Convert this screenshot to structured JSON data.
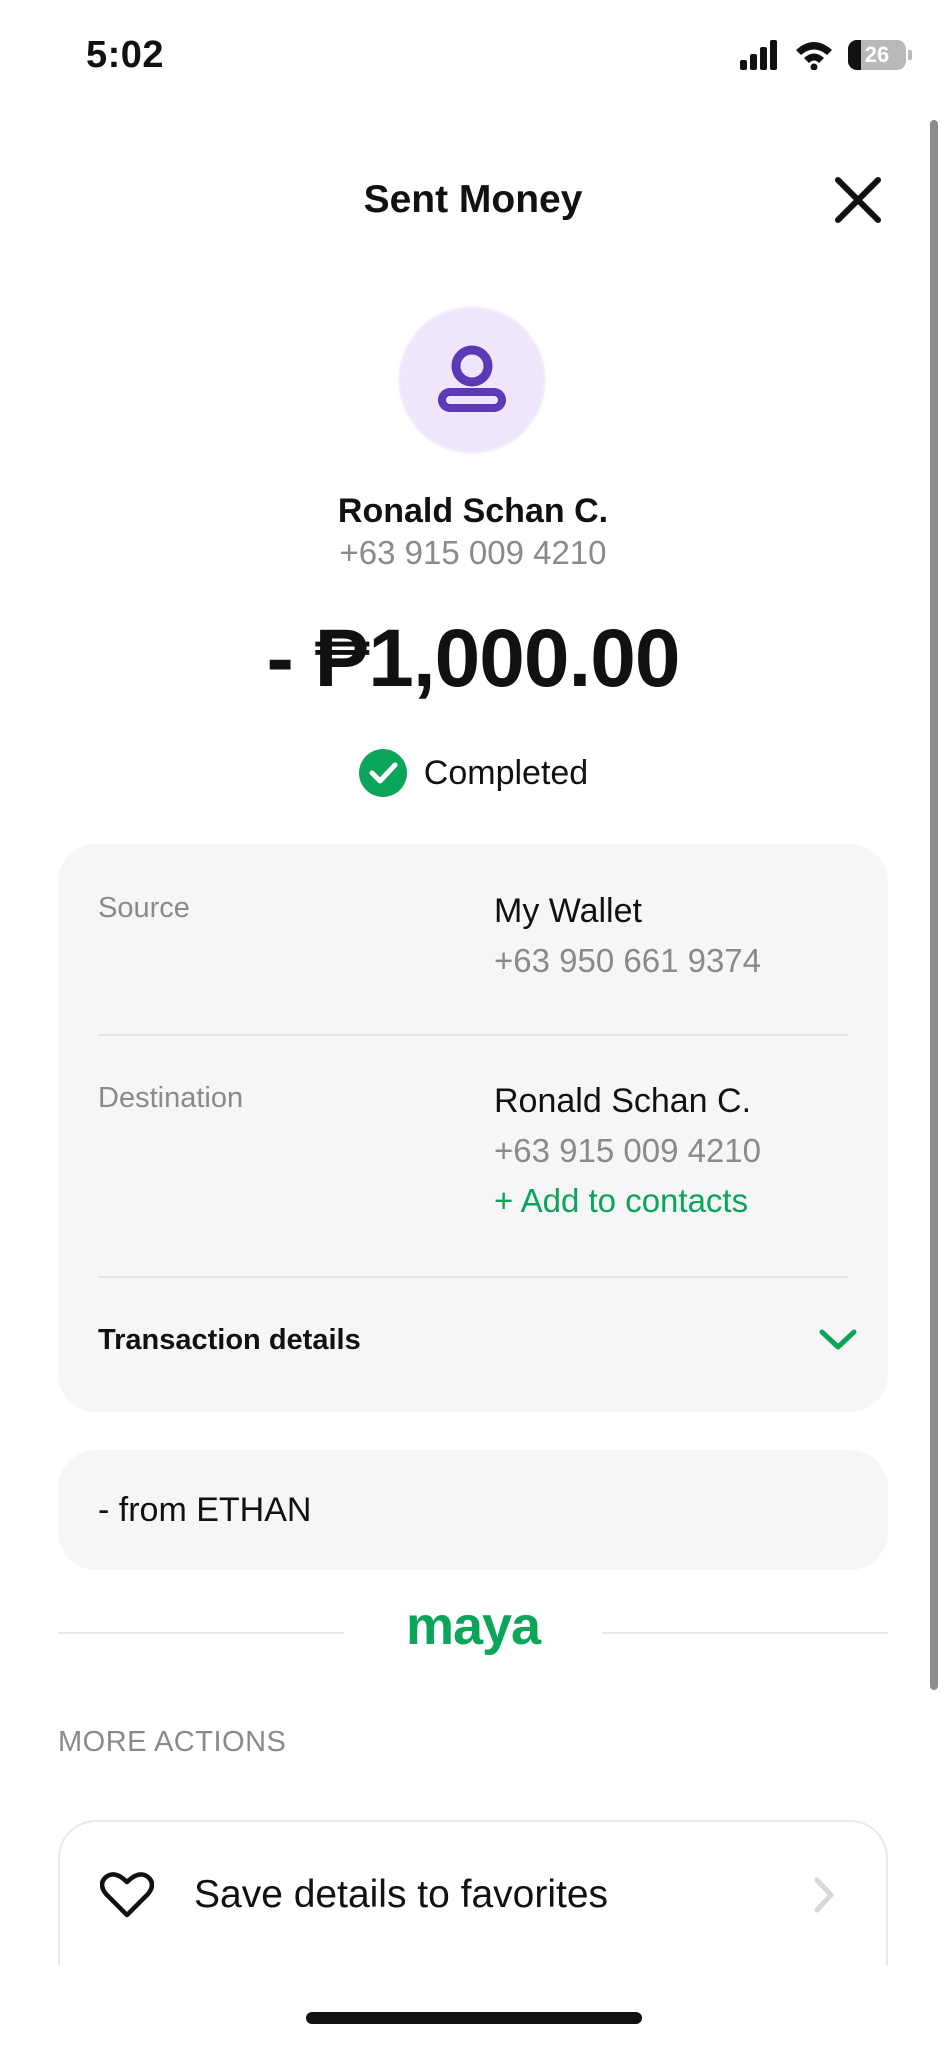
{
  "status_bar": {
    "time": "5:02",
    "battery": "26"
  },
  "header": {
    "title": "Sent Money"
  },
  "recipient": {
    "name": "Ronald Schan C.",
    "number": "+63 915 009 4210"
  },
  "amount": "- ₱1,000.00",
  "status": "Completed",
  "details": {
    "source_label": "Source",
    "source_name": "My Wallet",
    "source_number": "+63 950 661 9374",
    "destination_label": "Destination",
    "destination_name": "Ronald Schan C.",
    "destination_number": "+63 915 009 4210",
    "add_contact": "+ Add to contacts",
    "transaction_details": "Transaction details"
  },
  "note": "- from ETHAN",
  "brand": {
    "logo_text": "maya"
  },
  "more_actions": {
    "title": "MORE ACTIONS",
    "items": [
      {
        "label": "Save details to favorites"
      }
    ]
  },
  "colors": {
    "accent": "#0aa559",
    "avatar_bg": "#f0e6fb",
    "avatar_fg": "#5b3ab5",
    "card_bg": "#f6f6f8"
  },
  "icons": [
    "signal-icon",
    "wifi-icon",
    "battery-icon",
    "close-icon",
    "user-icon",
    "check-circle-icon",
    "chevron-down-icon",
    "heart-icon",
    "chevron-right-icon"
  ]
}
